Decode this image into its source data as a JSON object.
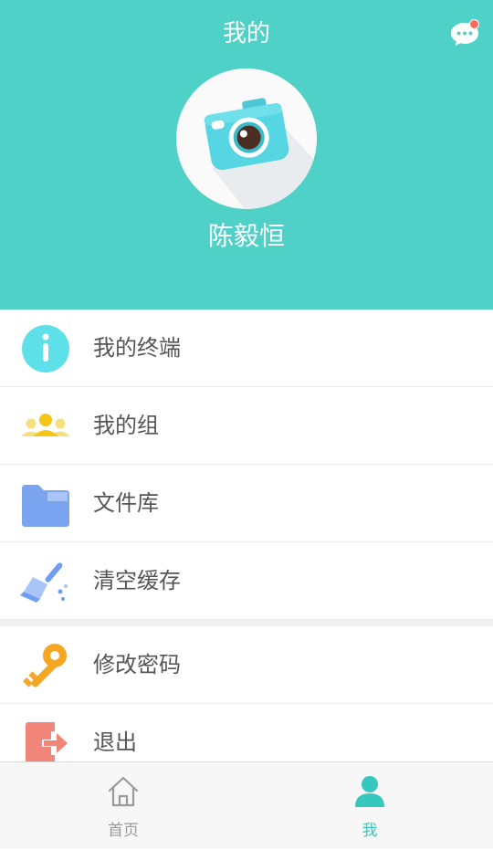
{
  "header": {
    "title": "我的",
    "username": "陈毅恒",
    "avatar_icon": "camera-icon",
    "message_icon": "chat-bubble-icon",
    "accent": "#4fd1c8",
    "notification_color": "#ff6b5b"
  },
  "menu": {
    "items": [
      {
        "label": "我的终端",
        "icon": "info-icon"
      },
      {
        "label": "我的组",
        "icon": "group-users-icon"
      },
      {
        "label": "文件库",
        "icon": "folder-icon"
      },
      {
        "label": "清空缓存",
        "icon": "broom-icon"
      },
      {
        "label": "修改密码",
        "icon": "key-icon"
      },
      {
        "label": "退出",
        "icon": "exit-icon"
      }
    ]
  },
  "tabbar": {
    "tabs": [
      {
        "label": "首页",
        "icon": "home-icon",
        "active": false
      },
      {
        "label": "我",
        "icon": "person-icon",
        "active": true
      }
    ],
    "active_color": "#36c8bd",
    "inactive_color": "#9a9a9a"
  }
}
